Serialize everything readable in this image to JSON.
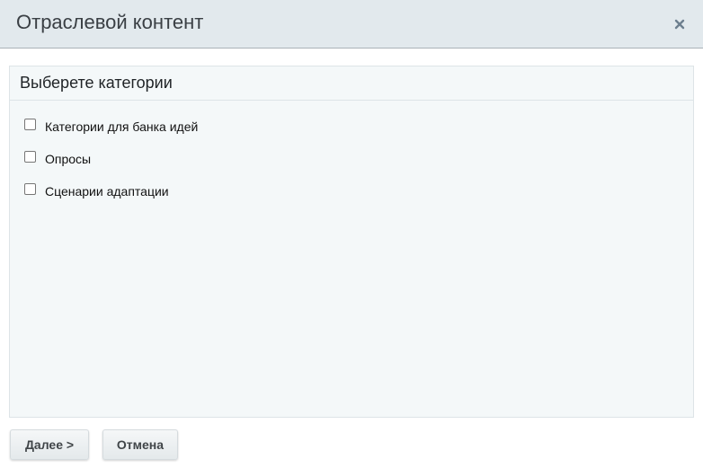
{
  "dialog": {
    "title": "Отраслевой контент",
    "close_icon": "close-icon"
  },
  "panel": {
    "title": "Выберете категории",
    "options": [
      {
        "label": "Категории для банка идей",
        "checked": false
      },
      {
        "label": "Опросы",
        "checked": false
      },
      {
        "label": "Сценарии адаптации",
        "checked": false
      }
    ]
  },
  "footer": {
    "next_label": "Далее >",
    "cancel_label": "Отмена"
  }
}
